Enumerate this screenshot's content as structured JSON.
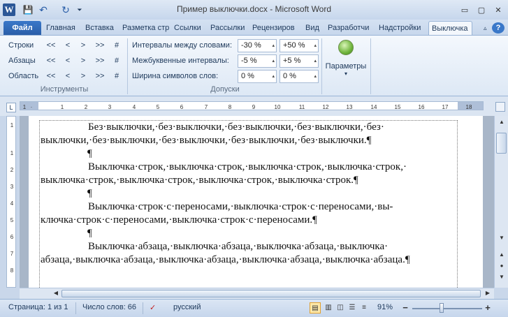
{
  "titlebar": {
    "title": "Пример выключки.docx - Microsoft Word",
    "logo_letter": "W",
    "qat_save": "💾",
    "qat_undo": "↶",
    "qat_redo": "↻",
    "qat_more": "⏷",
    "minimize": "▭",
    "restore": "▢",
    "close": "✕"
  },
  "tabs": {
    "file": "Файл",
    "items": [
      "Главная",
      "Вставка",
      "Разметка стр",
      "Ссылки",
      "Рассылки",
      "Рецензиров",
      "Вид",
      "Разработчи",
      "Надстройки"
    ],
    "active": "Выключка",
    "help_caret": "▵",
    "help_icon": "?"
  },
  "ribbon": {
    "tools": {
      "rows": [
        {
          "label": "Строки"
        },
        {
          "label": "Абзацы"
        },
        {
          "label": "Область"
        }
      ],
      "buttons": [
        "<<",
        "<",
        ">",
        ">>",
        "#"
      ],
      "title": "Инструменты"
    },
    "tolerances": {
      "word_spacing_label": "Интервалы между словами:",
      "letter_spacing_label": "Межбуквенные интервалы:",
      "char_width_label": "Ширина символов слов:",
      "word_min": "-30 %",
      "word_max": "+50 %",
      "letter_min": "-5 %",
      "letter_max": "+5 %",
      "width_min": "0 %",
      "width_max": "0 %",
      "title": "Допуски"
    },
    "params": {
      "label": "Параметры",
      "caret": "▾"
    }
  },
  "ruler": {
    "box": "L",
    "ticks": [
      "1",
      "2",
      "1",
      "2",
      "3",
      "4",
      "5",
      "6",
      "7",
      "8",
      "9",
      "10",
      "11",
      "12",
      "13",
      "14",
      "15",
      "16",
      "17",
      "18"
    ]
  },
  "vruler": {
    "ticks": [
      "1",
      "1",
      "2",
      "3",
      "4",
      "5",
      "6",
      "7",
      "8",
      "9"
    ]
  },
  "document": {
    "p1": "Без·выключки,·без·выключки,·без·выключки,·без·выключки,·без· выключки,·без·выключки,·без·выключки,·без·выключки,·без·выключки.¶",
    "m1": "¶",
    "p2": "Выключка·строк,·выключка·строк,·выключка·строк,·выключка·строк,· выключка·строк,·выключка·строк,·выключка·строк,·выключка·строк.¶",
    "m2": "¶",
    "p3": "Выключка·строк·с·переносами,·выключка·строк·с·переносами,·вы- ключка·строк·с·переносами,·выключка·строк·с·переносами.¶",
    "m3": "¶",
    "p4": "Выключка·абзаца,·выключка·абзаца,·выключка·абзаца,·выключка· абзаца,·выключка·абзаца,·выключка·абзаца,·выключка·абзаца,·выключка·абзаца.¶"
  },
  "scroll": {
    "up": "▲",
    "down": "▼",
    "left": "◀",
    "right": "▶",
    "prev_page": "▲",
    "browse": "●",
    "next_page": "▼"
  },
  "status": {
    "page": "Страница: 1 из 1",
    "words": "Число слов: 66",
    "lang": "русский",
    "zoom": "91%",
    "zoom_minus": "−",
    "zoom_plus": "+"
  }
}
